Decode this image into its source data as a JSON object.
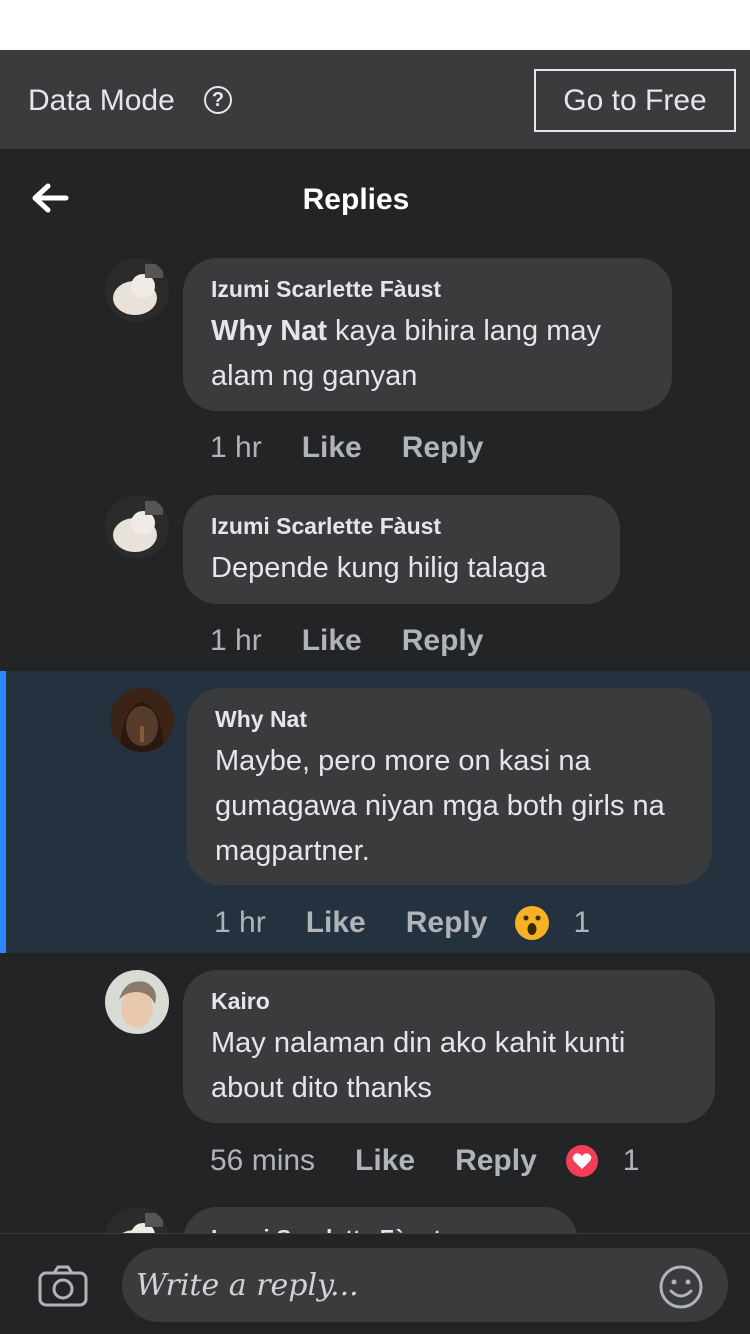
{
  "data_mode": {
    "label": "Data Mode",
    "help": "?",
    "go_free_label": "Go to Free"
  },
  "header": {
    "title": "Replies"
  },
  "comments": [
    {
      "author": "Izumi Scarlette Fàust",
      "mention": "Why Nat",
      "text": " kaya bihira lang may alam ng ganyan",
      "time": "1 hr",
      "like": "Like",
      "reply": "Reply"
    },
    {
      "author": "Izumi Scarlette Fàust",
      "text": "Depende kung hilig talaga",
      "time": "1 hr",
      "like": "Like",
      "reply": "Reply"
    },
    {
      "author": "Why Nat",
      "text": "Maybe, pero more on kasi na gumagawa niyan mga both girls na magpartner.",
      "time": "1 hr",
      "like": "Like",
      "reply": "Reply",
      "reaction": "wow",
      "reaction_count": "1",
      "highlighted": true
    },
    {
      "author": "Kairo",
      "text": "May nalaman din ako kahit kunti about dito thanks",
      "time": "56 mins",
      "like": "Like",
      "reply": "Reply",
      "reaction": "love",
      "reaction_count": "1"
    },
    {
      "author": "Izumi Scarlette Fàust"
    }
  ],
  "footer": {
    "placeholder": "Write a reply..."
  },
  "colors": {
    "accent": "#2d88ff",
    "love": "#f33e58",
    "wow": "#f7b125"
  }
}
